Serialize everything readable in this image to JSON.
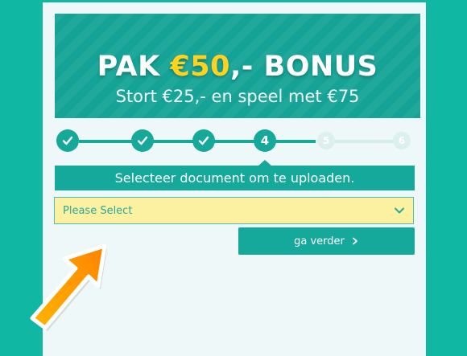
{
  "banner": {
    "title_prefix": "PAK ",
    "title_amount": "€50",
    "title_suffix": ",- BONUS",
    "subtitle": "Stort €25,- en speel met €75",
    "accent_color": "#ffd21e"
  },
  "stepper": {
    "steps": [
      {
        "state": "done",
        "icon": "check-icon"
      },
      {
        "state": "done",
        "icon": "check-icon"
      },
      {
        "state": "done",
        "icon": "check-icon"
      },
      {
        "state": "current",
        "label": "4"
      },
      {
        "state": "todo",
        "label": "5"
      },
      {
        "state": "todo",
        "label": "6"
      }
    ]
  },
  "upload": {
    "heading": "Selecteer document om te uploaden.",
    "select_value": "Please Select",
    "continue_label": "ga verder",
    "continue_icon": "chevron-right-icon"
  },
  "colors": {
    "background": "#10b8a3",
    "primary": "#14a99a",
    "select_bg": "#fbf1a0",
    "annotation_arrow": "#ff9a00"
  }
}
